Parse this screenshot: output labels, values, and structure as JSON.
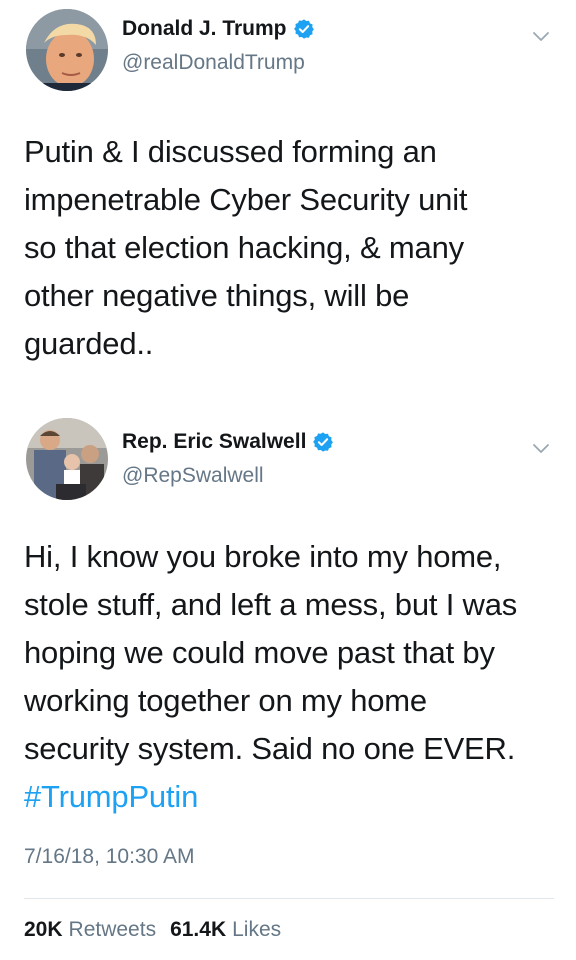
{
  "tweets": [
    {
      "display_name": "Donald J. Trump",
      "handle": "@realDonaldTrump",
      "verified": true,
      "avatar_icon": "avatar-photo-trump",
      "body_lines": [
        "Putin & I discussed forming an",
        "impenetrable Cyber Security unit",
        "so that election hacking, & many",
        "other negative things, will be",
        "guarded.."
      ]
    },
    {
      "display_name": "Rep. Eric Swalwell",
      "handle": "@RepSwalwell",
      "verified": true,
      "avatar_icon": "avatar-photo-swalwell",
      "body_lines": [
        "Hi, I know you broke into my home,",
        "stole stuff, and left a mess, but I was",
        "hoping we could move past that by",
        "working together on my home",
        "security system. Said no one EVER."
      ],
      "hashtag": "#TrumpPutin",
      "timestamp": "7/16/18, 10:30 AM",
      "stats": {
        "retweets_count": "20K",
        "retweets_label": "Retweets",
        "likes_count": "61.4K",
        "likes_label": "Likes"
      }
    }
  ],
  "colors": {
    "text": "#14171a",
    "secondary": "#657786",
    "link": "#1da1f2",
    "verified": "#1da1f2",
    "divider": "#e1e8ed"
  },
  "icons": {
    "verified": "verified-badge-icon",
    "menu": "chevron-down-icon"
  }
}
